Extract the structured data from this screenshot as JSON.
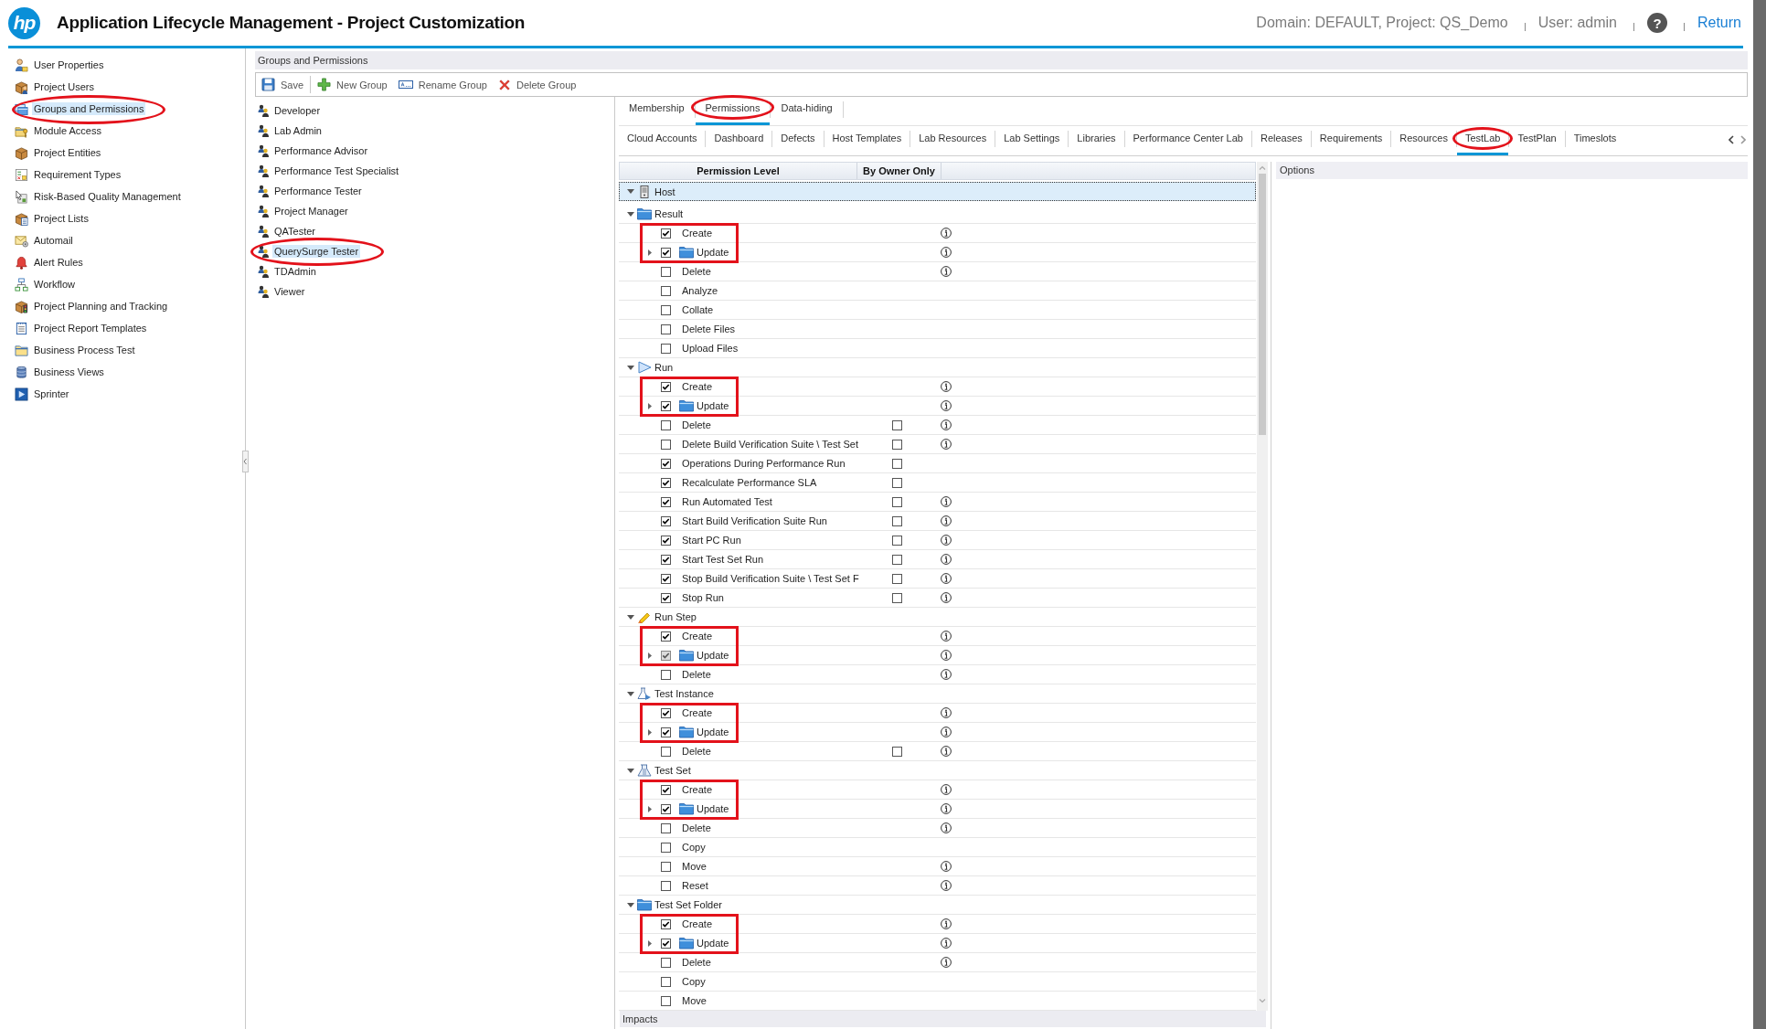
{
  "header": {
    "logo": "hp",
    "title": "Application Lifecycle Management - Project Customization",
    "context": "Domain: DEFAULT, Project: QS_Demo",
    "user": "User: admin",
    "help": "?",
    "return_link": "Return"
  },
  "sidebar": {
    "items": [
      {
        "label": "User Properties",
        "selected": false,
        "annotated": false
      },
      {
        "label": "Project Users",
        "selected": false,
        "annotated": false
      },
      {
        "label": "Groups and Permissions",
        "selected": true,
        "annotated": true
      },
      {
        "label": "Module Access",
        "selected": false,
        "annotated": false
      },
      {
        "label": "Project Entities",
        "selected": false,
        "annotated": false
      },
      {
        "label": "Requirement Types",
        "selected": false,
        "annotated": false
      },
      {
        "label": "Risk-Based Quality Management",
        "selected": false,
        "annotated": false
      },
      {
        "label": "Project Lists",
        "selected": false,
        "annotated": false
      },
      {
        "label": "Automail",
        "selected": false,
        "annotated": false
      },
      {
        "label": "Alert Rules",
        "selected": false,
        "annotated": false
      },
      {
        "label": "Workflow",
        "selected": false,
        "annotated": false
      },
      {
        "label": "Project Planning and Tracking",
        "selected": false,
        "annotated": false
      },
      {
        "label": "Project Report Templates",
        "selected": false,
        "annotated": false
      },
      {
        "label": "Business Process Test",
        "selected": false,
        "annotated": false
      },
      {
        "label": "Business Views",
        "selected": false,
        "annotated": false
      },
      {
        "label": "Sprinter",
        "selected": false,
        "annotated": false
      }
    ]
  },
  "groups_panel": {
    "title": "Groups and Permissions",
    "toolbar": [
      {
        "label": "Save"
      },
      {
        "label": "New Group"
      },
      {
        "label": "Rename Group"
      },
      {
        "label": "Delete Group"
      }
    ],
    "groups": [
      {
        "label": "Developer",
        "selected": false,
        "annotated": false
      },
      {
        "label": "Lab Admin",
        "selected": false,
        "annotated": false
      },
      {
        "label": "Performance Advisor",
        "selected": false,
        "annotated": false
      },
      {
        "label": "Performance Test Specialist",
        "selected": false,
        "annotated": false
      },
      {
        "label": "Performance Tester",
        "selected": false,
        "annotated": false
      },
      {
        "label": "Project Manager",
        "selected": false,
        "annotated": false
      },
      {
        "label": "QATester",
        "selected": false,
        "annotated": false
      },
      {
        "label": "QuerySurge Tester",
        "selected": true,
        "annotated": true
      },
      {
        "label": "TDAdmin",
        "selected": false,
        "annotated": false
      },
      {
        "label": "Viewer",
        "selected": false,
        "annotated": false
      }
    ]
  },
  "detail_tabs": [
    {
      "label": "Membership",
      "selected": false,
      "annotated": false
    },
    {
      "label": "Permissions",
      "selected": true,
      "annotated": true
    },
    {
      "label": "Data-hiding",
      "selected": false,
      "annotated": false
    }
  ],
  "module_tabs": [
    {
      "label": "Cloud Accounts",
      "selected": false,
      "annotated": false
    },
    {
      "label": "Dashboard",
      "selected": false,
      "annotated": false
    },
    {
      "label": "Defects",
      "selected": false,
      "annotated": false
    },
    {
      "label": "Host Templates",
      "selected": false,
      "annotated": false
    },
    {
      "label": "Lab Resources",
      "selected": false,
      "annotated": false
    },
    {
      "label": "Lab Settings",
      "selected": false,
      "annotated": false
    },
    {
      "label": "Libraries",
      "selected": false,
      "annotated": false
    },
    {
      "label": "Performance Center Lab",
      "selected": false,
      "annotated": false
    },
    {
      "label": "Releases",
      "selected": false,
      "annotated": false
    },
    {
      "label": "Requirements",
      "selected": false,
      "annotated": false
    },
    {
      "label": "Resources",
      "selected": false,
      "annotated": false
    },
    {
      "label": "TestLab",
      "selected": true,
      "annotated": true
    },
    {
      "label": "TestPlan",
      "selected": false,
      "annotated": false
    },
    {
      "label": "Timeslots",
      "selected": false,
      "annotated": false
    }
  ],
  "permissions": {
    "columns": [
      "Permission Level",
      "By Owner Only"
    ],
    "root": {
      "label": "Host",
      "selected": true,
      "expanded": true
    },
    "groups": [
      {
        "label": "Result",
        "expanded": true,
        "rows": [
          {
            "label": "Create",
            "kind": "action",
            "checked": true,
            "info": true,
            "annotated": true
          },
          {
            "label": "Update",
            "kind": "folder",
            "checked": true,
            "partial": false,
            "expanded": false,
            "info": true,
            "annotated": true
          },
          {
            "label": "Delete",
            "kind": "action",
            "checked": false,
            "info": true,
            "annotated": false
          },
          {
            "label": "Analyze",
            "kind": "action",
            "checked": false,
            "info": false,
            "annotated": false
          },
          {
            "label": "Collate",
            "kind": "action",
            "checked": false,
            "info": false,
            "annotated": false
          },
          {
            "label": "Delete Files",
            "kind": "action",
            "checked": false,
            "info": false,
            "annotated": false
          },
          {
            "label": "Upload Files",
            "kind": "action",
            "checked": false,
            "info": false,
            "annotated": false
          }
        ]
      },
      {
        "label": "Run",
        "expanded": true,
        "rows": [
          {
            "label": "Create",
            "kind": "action",
            "checked": true,
            "info": true,
            "annotated": true
          },
          {
            "label": "Update",
            "kind": "folder",
            "checked": true,
            "partial": false,
            "expanded": false,
            "info": true,
            "annotated": true
          },
          {
            "label": "Delete",
            "kind": "action",
            "checked": false,
            "owner_only": {
              "checked": false
            },
            "info": true,
            "annotated": false
          },
          {
            "label": "Delete Build Verification Suite \\ Test Set",
            "kind": "action",
            "checked": false,
            "owner_only": {
              "checked": false
            },
            "info": true,
            "annotated": false
          },
          {
            "label": "Operations During Performance Run",
            "kind": "action",
            "checked": true,
            "owner_only": {
              "checked": false
            },
            "info": false,
            "annotated": false
          },
          {
            "label": "Recalculate Performance SLA",
            "kind": "action",
            "checked": true,
            "owner_only": {
              "checked": false
            },
            "info": false,
            "annotated": false
          },
          {
            "label": "Run Automated Test",
            "kind": "action",
            "checked": true,
            "owner_only": {
              "checked": false
            },
            "info": true,
            "annotated": false
          },
          {
            "label": "Start Build Verification Suite Run",
            "kind": "action",
            "checked": true,
            "owner_only": {
              "checked": false
            },
            "info": true,
            "annotated": false
          },
          {
            "label": "Start PC Run",
            "kind": "action",
            "checked": true,
            "owner_only": {
              "checked": false
            },
            "info": true,
            "annotated": false
          },
          {
            "label": "Start Test Set Run",
            "kind": "action",
            "checked": true,
            "owner_only": {
              "checked": false
            },
            "info": true,
            "annotated": false
          },
          {
            "label": "Stop Build Verification Suite \\ Test Set F",
            "kind": "action",
            "checked": true,
            "owner_only": {
              "checked": false
            },
            "info": true,
            "annotated": false
          },
          {
            "label": "Stop Run",
            "kind": "action",
            "checked": true,
            "owner_only": {
              "checked": false
            },
            "info": true,
            "annotated": false
          }
        ]
      },
      {
        "label": "Run Step",
        "expanded": true,
        "rows": [
          {
            "label": "Create",
            "kind": "action",
            "checked": true,
            "info": true,
            "annotated": true
          },
          {
            "label": "Update",
            "kind": "folder",
            "checked": true,
            "partial": true,
            "expanded": false,
            "info": true,
            "annotated": true
          },
          {
            "label": "Delete",
            "kind": "action",
            "checked": false,
            "info": true,
            "annotated": false
          }
        ]
      },
      {
        "label": "Test Instance",
        "expanded": true,
        "rows": [
          {
            "label": "Create",
            "kind": "action",
            "checked": true,
            "info": true,
            "annotated": true
          },
          {
            "label": "Update",
            "kind": "folder",
            "checked": true,
            "partial": false,
            "expanded": false,
            "info": true,
            "annotated": true
          },
          {
            "label": "Delete",
            "kind": "action",
            "checked": false,
            "owner_only": {
              "checked": false
            },
            "info": true,
            "annotated": false
          }
        ]
      },
      {
        "label": "Test Set",
        "expanded": true,
        "rows": [
          {
            "label": "Create",
            "kind": "action",
            "checked": true,
            "info": true,
            "annotated": true
          },
          {
            "label": "Update",
            "kind": "folder",
            "checked": true,
            "partial": false,
            "expanded": false,
            "info": true,
            "annotated": true
          },
          {
            "label": "Delete",
            "kind": "action",
            "checked": false,
            "info": true,
            "annotated": false
          },
          {
            "label": "Copy",
            "kind": "action",
            "checked": false,
            "info": false,
            "annotated": false
          },
          {
            "label": "Move",
            "kind": "action",
            "checked": false,
            "info": true,
            "annotated": false
          },
          {
            "label": "Reset",
            "kind": "action",
            "checked": false,
            "info": true,
            "annotated": false
          }
        ]
      },
      {
        "label": "Test Set Folder",
        "expanded": true,
        "rows": [
          {
            "label": "Create",
            "kind": "action",
            "checked": true,
            "info": true,
            "annotated": true
          },
          {
            "label": "Update",
            "kind": "folder",
            "checked": true,
            "partial": false,
            "expanded": false,
            "info": true,
            "annotated": true
          },
          {
            "label": "Delete",
            "kind": "action",
            "checked": false,
            "info": true,
            "annotated": false
          },
          {
            "label": "Copy",
            "kind": "action",
            "checked": false,
            "info": false,
            "annotated": false
          },
          {
            "label": "Move",
            "kind": "action",
            "checked": false,
            "info": false,
            "annotated": false
          }
        ]
      }
    ]
  },
  "options": {
    "title": "Options"
  },
  "impacts": {
    "title": "Impacts"
  }
}
